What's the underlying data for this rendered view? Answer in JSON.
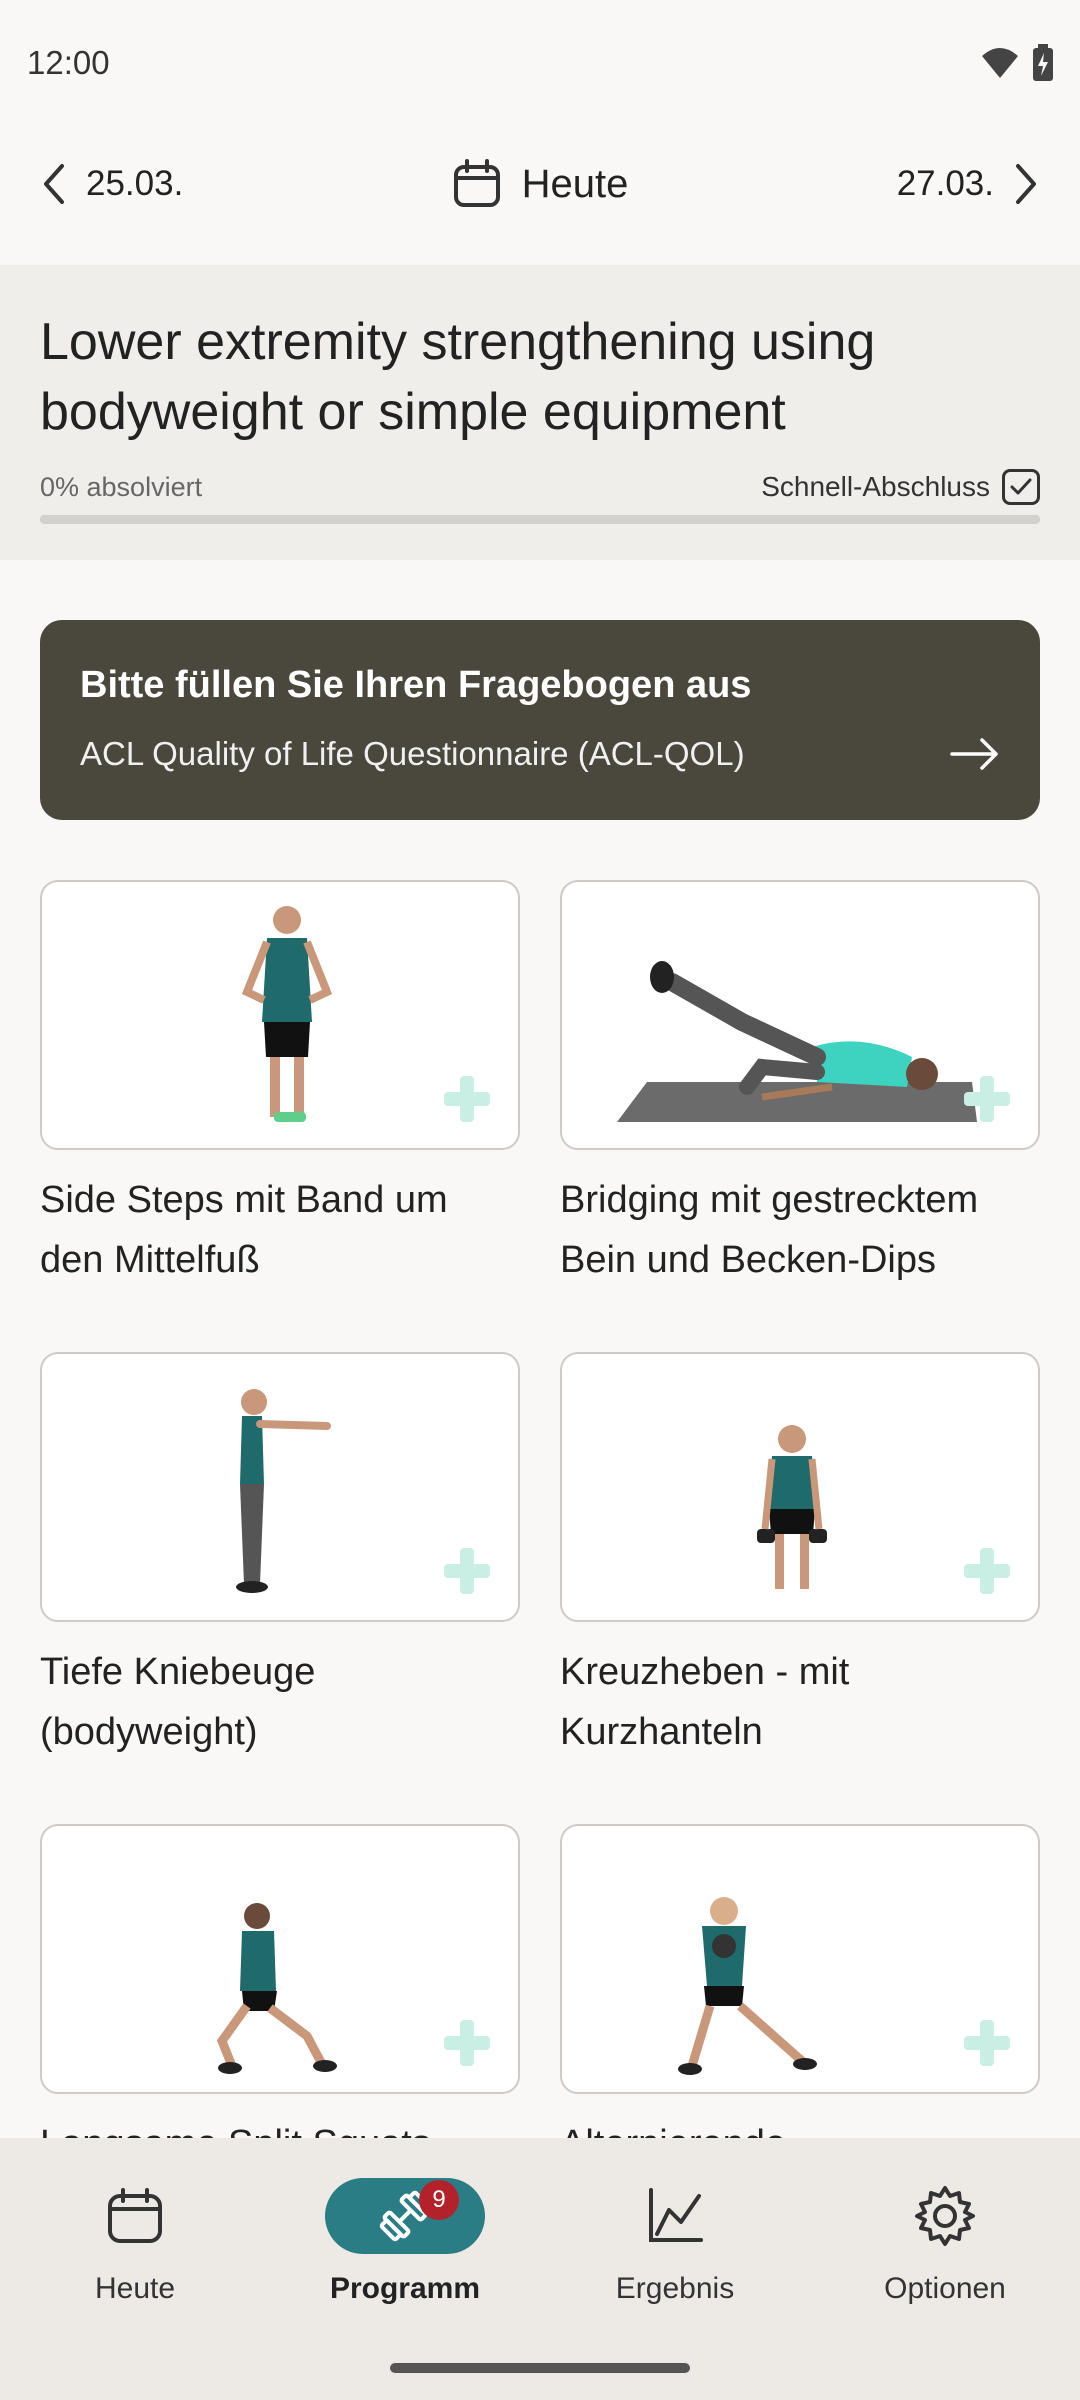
{
  "status": {
    "time": "12:00",
    "icons": [
      "wifi-icon",
      "battery-icon"
    ]
  },
  "date_nav": {
    "prev_label": "25.03.",
    "current_label": "Heute",
    "next_label": "27.03."
  },
  "program": {
    "title": "Lower extremity strengthening using bodyweight or simple equipment",
    "progress_label": "0% absolviert",
    "progress_fraction": 0,
    "quick_complete_label": "Schnell-Abschluss"
  },
  "banner": {
    "title": "Bitte füllen Sie Ihren Fragebogen aus",
    "subtitle": "ACL Quality of Life Questionnaire (ACL-QOL)"
  },
  "exercises": [
    {
      "label": "Side Steps mit Band um den Mittelfuß"
    },
    {
      "label": "Bridging mit gestrecktem Bein und Becken-Dips"
    },
    {
      "label": "Tiefe Kniebeuge (bodyweight)"
    },
    {
      "label": "Kreuzheben - mit Kurzhanteln"
    },
    {
      "label": "Langsame Split Squats"
    },
    {
      "label": "Alternierende"
    }
  ],
  "bottom_nav": {
    "items": [
      {
        "label": "Heute",
        "icon": "calendar-icon"
      },
      {
        "label": "Programm",
        "icon": "dumbbell-icon",
        "badge": "9",
        "active": true
      },
      {
        "label": "Ergebnis",
        "icon": "chart-icon"
      },
      {
        "label": "Optionen",
        "icon": "gear-icon"
      }
    ]
  },
  "colors": {
    "accent": "#2a7d84",
    "banner_bg": "#4a473c",
    "badge": "#b3222a"
  }
}
